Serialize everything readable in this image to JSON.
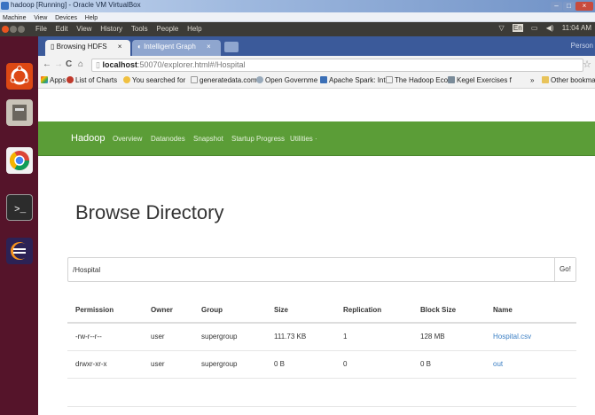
{
  "vbox": {
    "title": "hadoop [Running] - Oracle VM VirtualBox",
    "menu": [
      "Machine",
      "View",
      "Devices",
      "Help"
    ]
  },
  "ubuntu": {
    "menu": [
      "File",
      "Edit",
      "View",
      "History",
      "Tools",
      "People",
      "Help"
    ],
    "keyboard": "En",
    "time": "11:04 AM"
  },
  "chrome": {
    "tabs": [
      {
        "label": "Browsing HDFS",
        "close": "×"
      },
      {
        "label": "Intelligent Graph",
        "close": "×"
      }
    ],
    "profile": "Person",
    "url_host": "localhost",
    "url_rest": ":50070/explorer.html#/Hospital",
    "bookmarks": [
      "Apps",
      "List of Charts",
      "You searched for",
      "generatedata.com",
      "Open Governme",
      "Apache Spark: Int",
      "The Hadoop Ecos",
      "Kegel Exercises f"
    ],
    "other_bookmarks": "Other bookmar",
    "more": "»"
  },
  "hadoop": {
    "brand": "Hadoop",
    "nav": [
      "Overview",
      "Datanodes",
      "Snapshot",
      "Startup Progress",
      "Utilities ·"
    ],
    "heading": "Browse Directory",
    "path_value": "/Hospital",
    "go_label": "Go!",
    "columns": [
      "Permission",
      "Owner",
      "Group",
      "Size",
      "Replication",
      "Block Size",
      "Name"
    ],
    "rows": [
      [
        "-rw-r--r--",
        "user",
        "supergroup",
        "111.73 KB",
        "1",
        "128 MB",
        "Hospital.csv"
      ],
      [
        "drwxr-xr-x",
        "user",
        "supergroup",
        "0 B",
        "0",
        "0 B",
        "out"
      ]
    ]
  }
}
